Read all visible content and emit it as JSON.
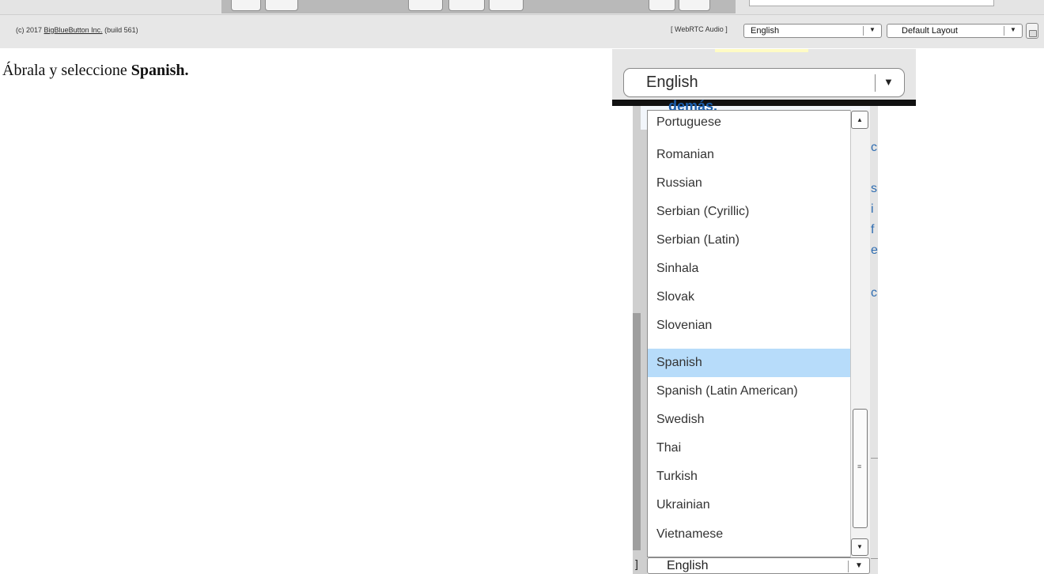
{
  "status_bar": {
    "copyright_prefix": "(c) 2017",
    "company_link": "BigBlueButton Inc.",
    "build": "(build 561)",
    "audio_label": "[ WebRTC Audio ]",
    "language_value": "English",
    "layout_value": "Default Layout"
  },
  "instruction": {
    "text": "Ábrala y seleccione",
    "bold": "Spanish."
  },
  "zoom": {
    "language_value": "English"
  },
  "background_peek": {
    "heading": "demás."
  },
  "dropdown": {
    "options": [
      "Portuguese",
      "Romanian",
      "Russian",
      "Serbian (Cyrillic)",
      "Serbian (Latin)",
      "Sinhala",
      "Slovak",
      "Slovenian",
      "Spanish",
      "Spanish (Latin American)",
      "Swedish",
      "Thai",
      "Turkish",
      "Ukrainian",
      "Vietnamese"
    ],
    "selected": "Spanish",
    "bottom_value": "English"
  },
  "icons": {
    "dropdown_arrow": "chevron-down-icon",
    "scroll_up": "scroll-up-arrow-icon",
    "scroll_down": "scroll-down-arrow-icon",
    "lock": "lock-icon",
    "grip": "grip-icon"
  },
  "colors": {
    "selected_row": "#b7dcfa",
    "link_blue": "#1b5fae"
  }
}
